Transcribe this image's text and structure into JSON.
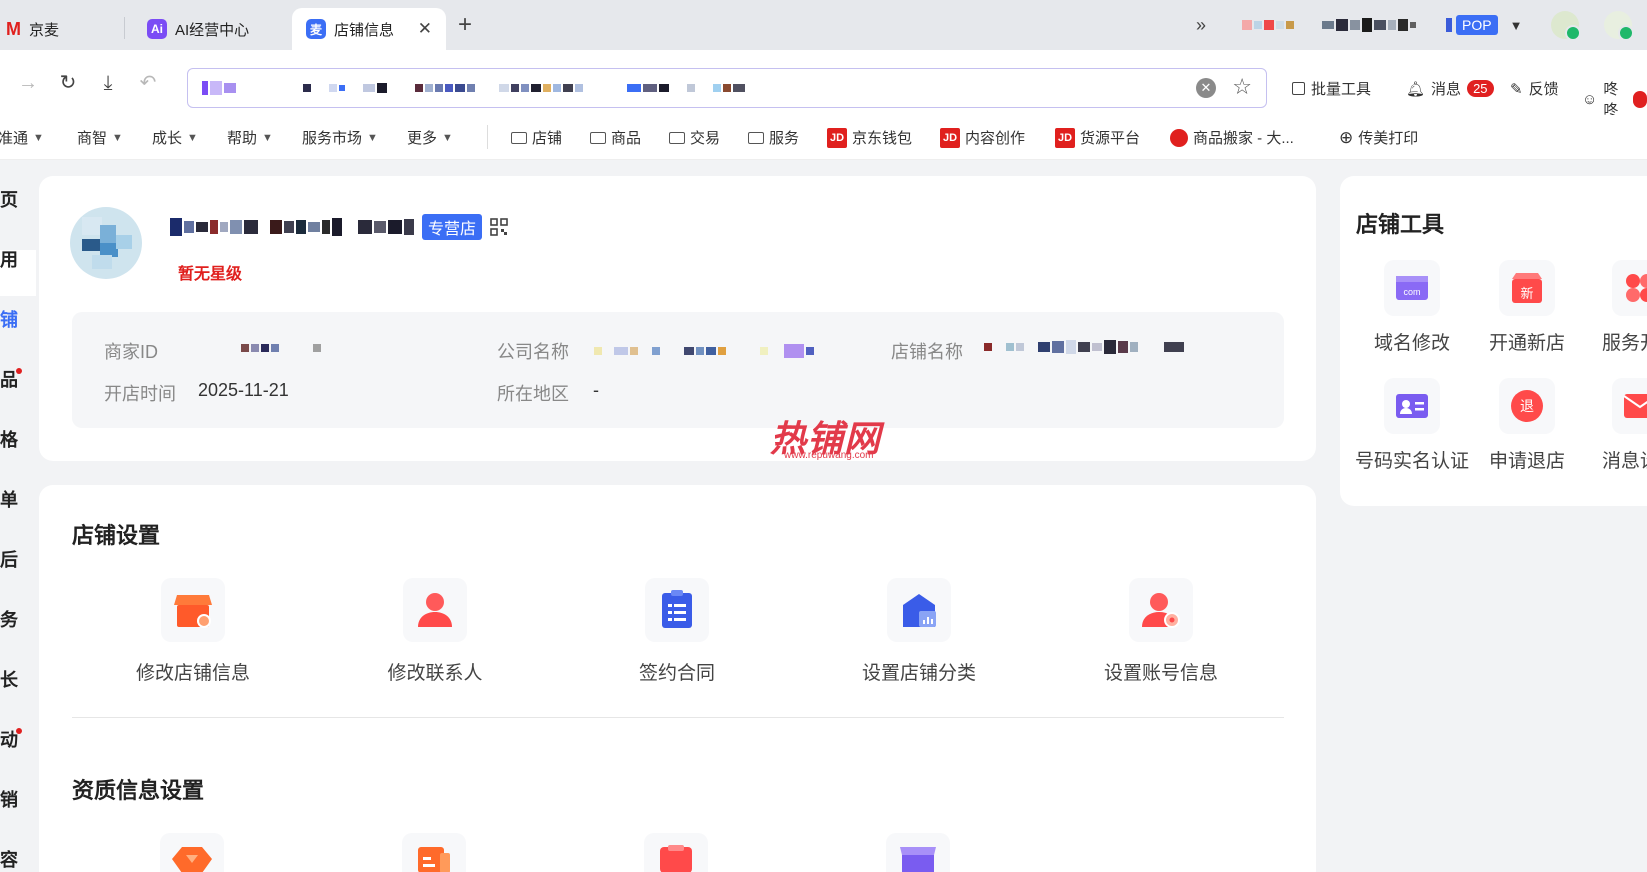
{
  "tabs": [
    {
      "label": "京麦",
      "icon": "jingmai-logo-icon"
    },
    {
      "label": "AI经营中心",
      "icon": "ai-icon"
    },
    {
      "label": "店铺信息",
      "icon": "mai-icon",
      "active": true
    }
  ],
  "toolbar_right": {
    "pop_label": "POP"
  },
  "nav_right": {
    "bulk_tools": "批量工具",
    "messages": "消息",
    "messages_count": "25",
    "feedback": "反馈",
    "dongdong": "咚咚"
  },
  "bookmarks": {
    "menus": [
      "准通",
      "商智",
      "成长",
      "帮助",
      "服务市场",
      "更多"
    ],
    "folders": [
      "店铺",
      "商品",
      "交易",
      "服务"
    ],
    "links": [
      "京东钱包",
      "内容创作",
      "货源平台"
    ],
    "jd_label": "JD",
    "move_goods": "商品搬家 - 大...",
    "chuanmei_print": "传美打印"
  },
  "sidebar": {
    "items": [
      {
        "label": "页",
        "dot": false
      },
      {
        "label": "用",
        "dot": false
      },
      {
        "label": "铺",
        "dot": false,
        "active": true
      },
      {
        "label": "品",
        "dot": true
      },
      {
        "label": "格",
        "dot": false
      },
      {
        "label": "单",
        "dot": false
      },
      {
        "label": "后",
        "dot": false
      },
      {
        "label": "务",
        "dot": false
      },
      {
        "label": "长",
        "dot": false
      },
      {
        "label": "动",
        "dot": true
      },
      {
        "label": "销",
        "dot": false
      },
      {
        "label": "容",
        "dot": false
      }
    ]
  },
  "shop": {
    "type_tag": "专营店",
    "star_level": "暂无星级",
    "merchant_id_label": "商家ID",
    "company_label": "公司名称",
    "shop_name_label": "店铺名称",
    "open_time_label": "开店时间",
    "open_time": "2025-11-21",
    "region_label": "所在地区",
    "region": "-"
  },
  "store_settings": {
    "title": "店铺设置",
    "items": [
      {
        "label": "修改店铺信息",
        "icon": "shop-edit-icon"
      },
      {
        "label": "修改联系人",
        "icon": "contact-person-icon"
      },
      {
        "label": "签约合同",
        "icon": "contract-icon"
      },
      {
        "label": "设置店铺分类",
        "icon": "shop-category-icon"
      },
      {
        "label": "设置账号信息",
        "icon": "account-settings-icon"
      }
    ]
  },
  "qualification": {
    "title": "资质信息设置"
  },
  "store_tools": {
    "title": "店铺工具",
    "items": [
      {
        "label": "域名修改",
        "icon": "domain-icon"
      },
      {
        "label": "开通新店",
        "icon": "new-store-icon"
      },
      {
        "label": "服务开",
        "icon": "service-icon"
      },
      {
        "label": "号码实名认证",
        "icon": "id-card-icon"
      },
      {
        "label": "申请退店",
        "icon": "quit-store-icon"
      },
      {
        "label": "消息设",
        "icon": "message-icon"
      }
    ],
    "domain_text": "com",
    "new_text": "新",
    "quit_text": "退"
  },
  "watermark": {
    "main": "热铺网",
    "sub": "www.repuwang.com"
  },
  "colors": {
    "accent": "#3b6ef5",
    "danger": "#e0201e",
    "page_bg": "#f2f3f5"
  }
}
